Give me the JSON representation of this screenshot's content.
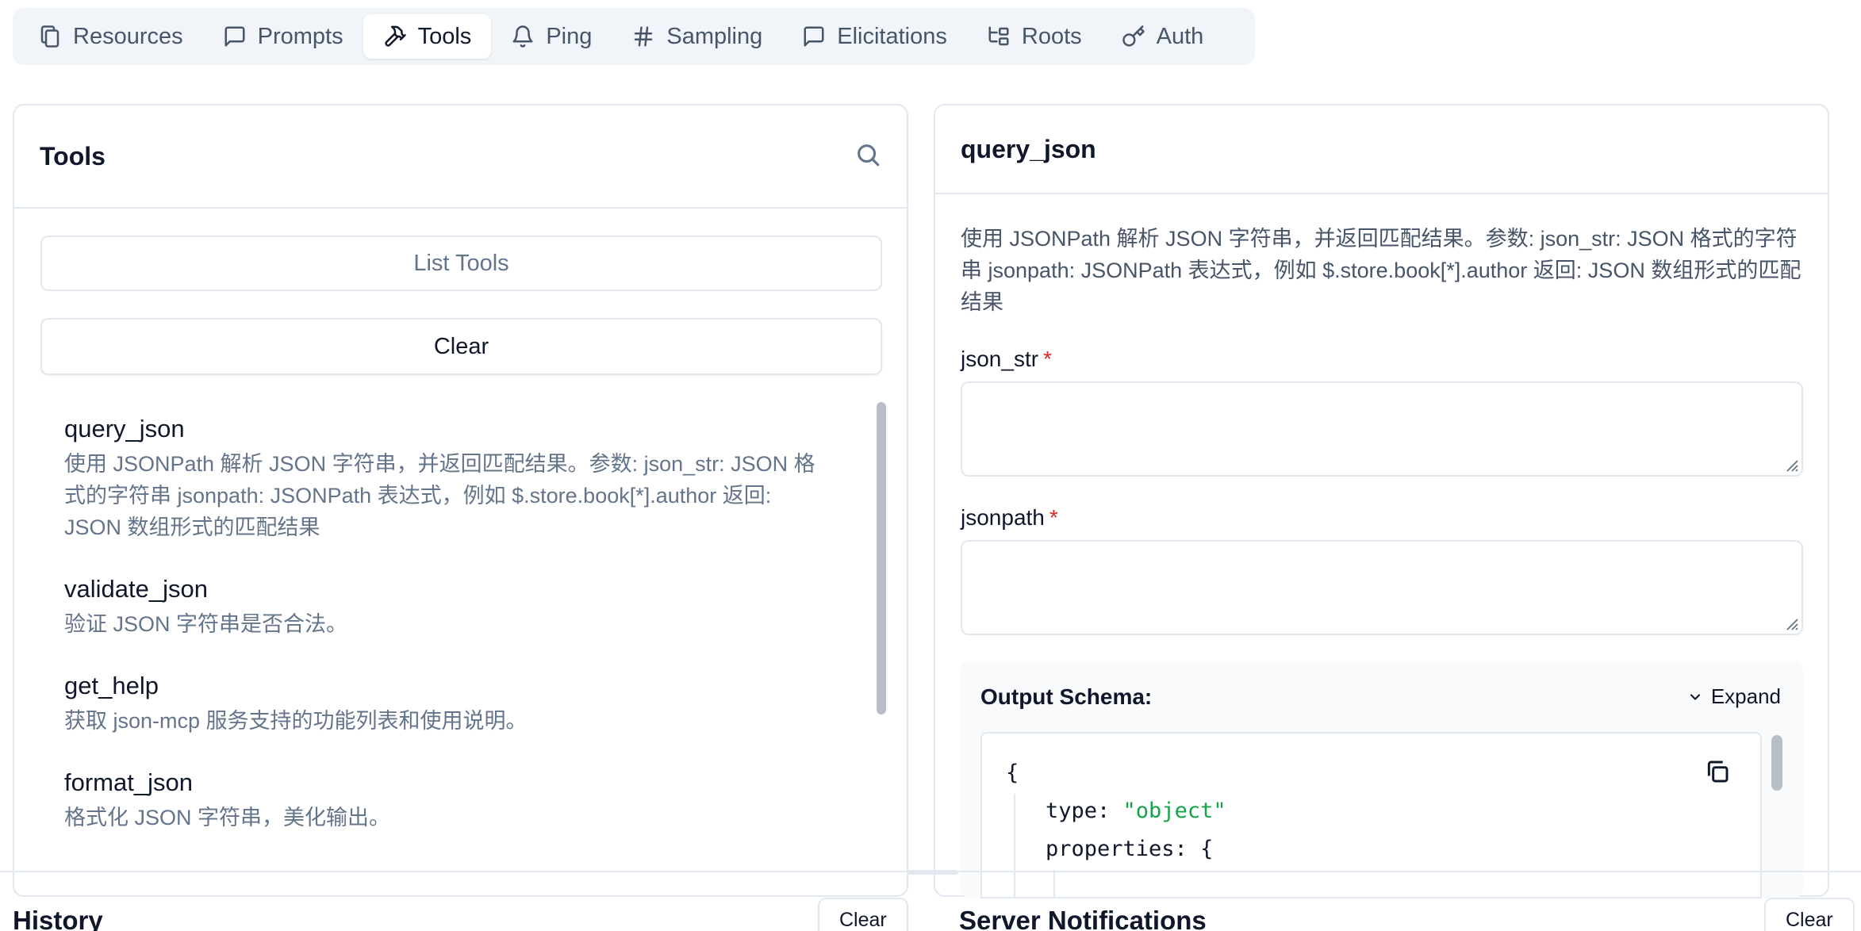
{
  "tabs": [
    {
      "label": "Resources",
      "icon": "files-icon"
    },
    {
      "label": "Prompts",
      "icon": "message-square-icon"
    },
    {
      "label": "Tools",
      "icon": "hammer-icon",
      "active": true
    },
    {
      "label": "Ping",
      "icon": "bell-icon"
    },
    {
      "label": "Sampling",
      "icon": "hash-icon"
    },
    {
      "label": "Elicitations",
      "icon": "message-square-icon"
    },
    {
      "label": "Roots",
      "icon": "folder-tree-icon"
    },
    {
      "label": "Auth",
      "icon": "key-icon"
    }
  ],
  "tools_panel": {
    "title": "Tools",
    "list_button": "List Tools",
    "clear_button": "Clear",
    "items": [
      {
        "name": "query_json",
        "description": "使用 JSONPath 解析 JSON 字符串，并返回匹配结果。参数: json_str: JSON 格式的字符串 jsonpath: JSONPath 表达式，例如 $.store.book[*].author 返回: JSON 数组形式的匹配结果"
      },
      {
        "name": "validate_json",
        "description": "验证 JSON 字符串是否合法。"
      },
      {
        "name": "get_help",
        "description": "获取 json-mcp 服务支持的功能列表和使用说明。"
      },
      {
        "name": "format_json",
        "description": "格式化 JSON 字符串，美化输出。"
      }
    ]
  },
  "detail_panel": {
    "title": "query_json",
    "description": "使用 JSONPath 解析 JSON 字符串，并返回匹配结果。参数: json_str: JSON 格式的字符串 jsonpath: JSONPath 表达式，例如 $.store.book[*].author 返回: JSON 数组形式的匹配结果",
    "fields": [
      {
        "label": "json_str",
        "required_mark": "*",
        "value": ""
      },
      {
        "label": "jsonpath",
        "required_mark": "*",
        "value": ""
      }
    ],
    "output_schema": {
      "title": "Output Schema:",
      "expand_label": "Expand",
      "open_brace": "{",
      "type_key": "type:",
      "type_value": "\"object\"",
      "properties_key": "properties:",
      "properties_brace": "{"
    }
  },
  "history": {
    "title": "History",
    "clear_label": "Clear"
  },
  "notifications": {
    "title": "Server Notifications",
    "clear_label": "Clear"
  }
}
